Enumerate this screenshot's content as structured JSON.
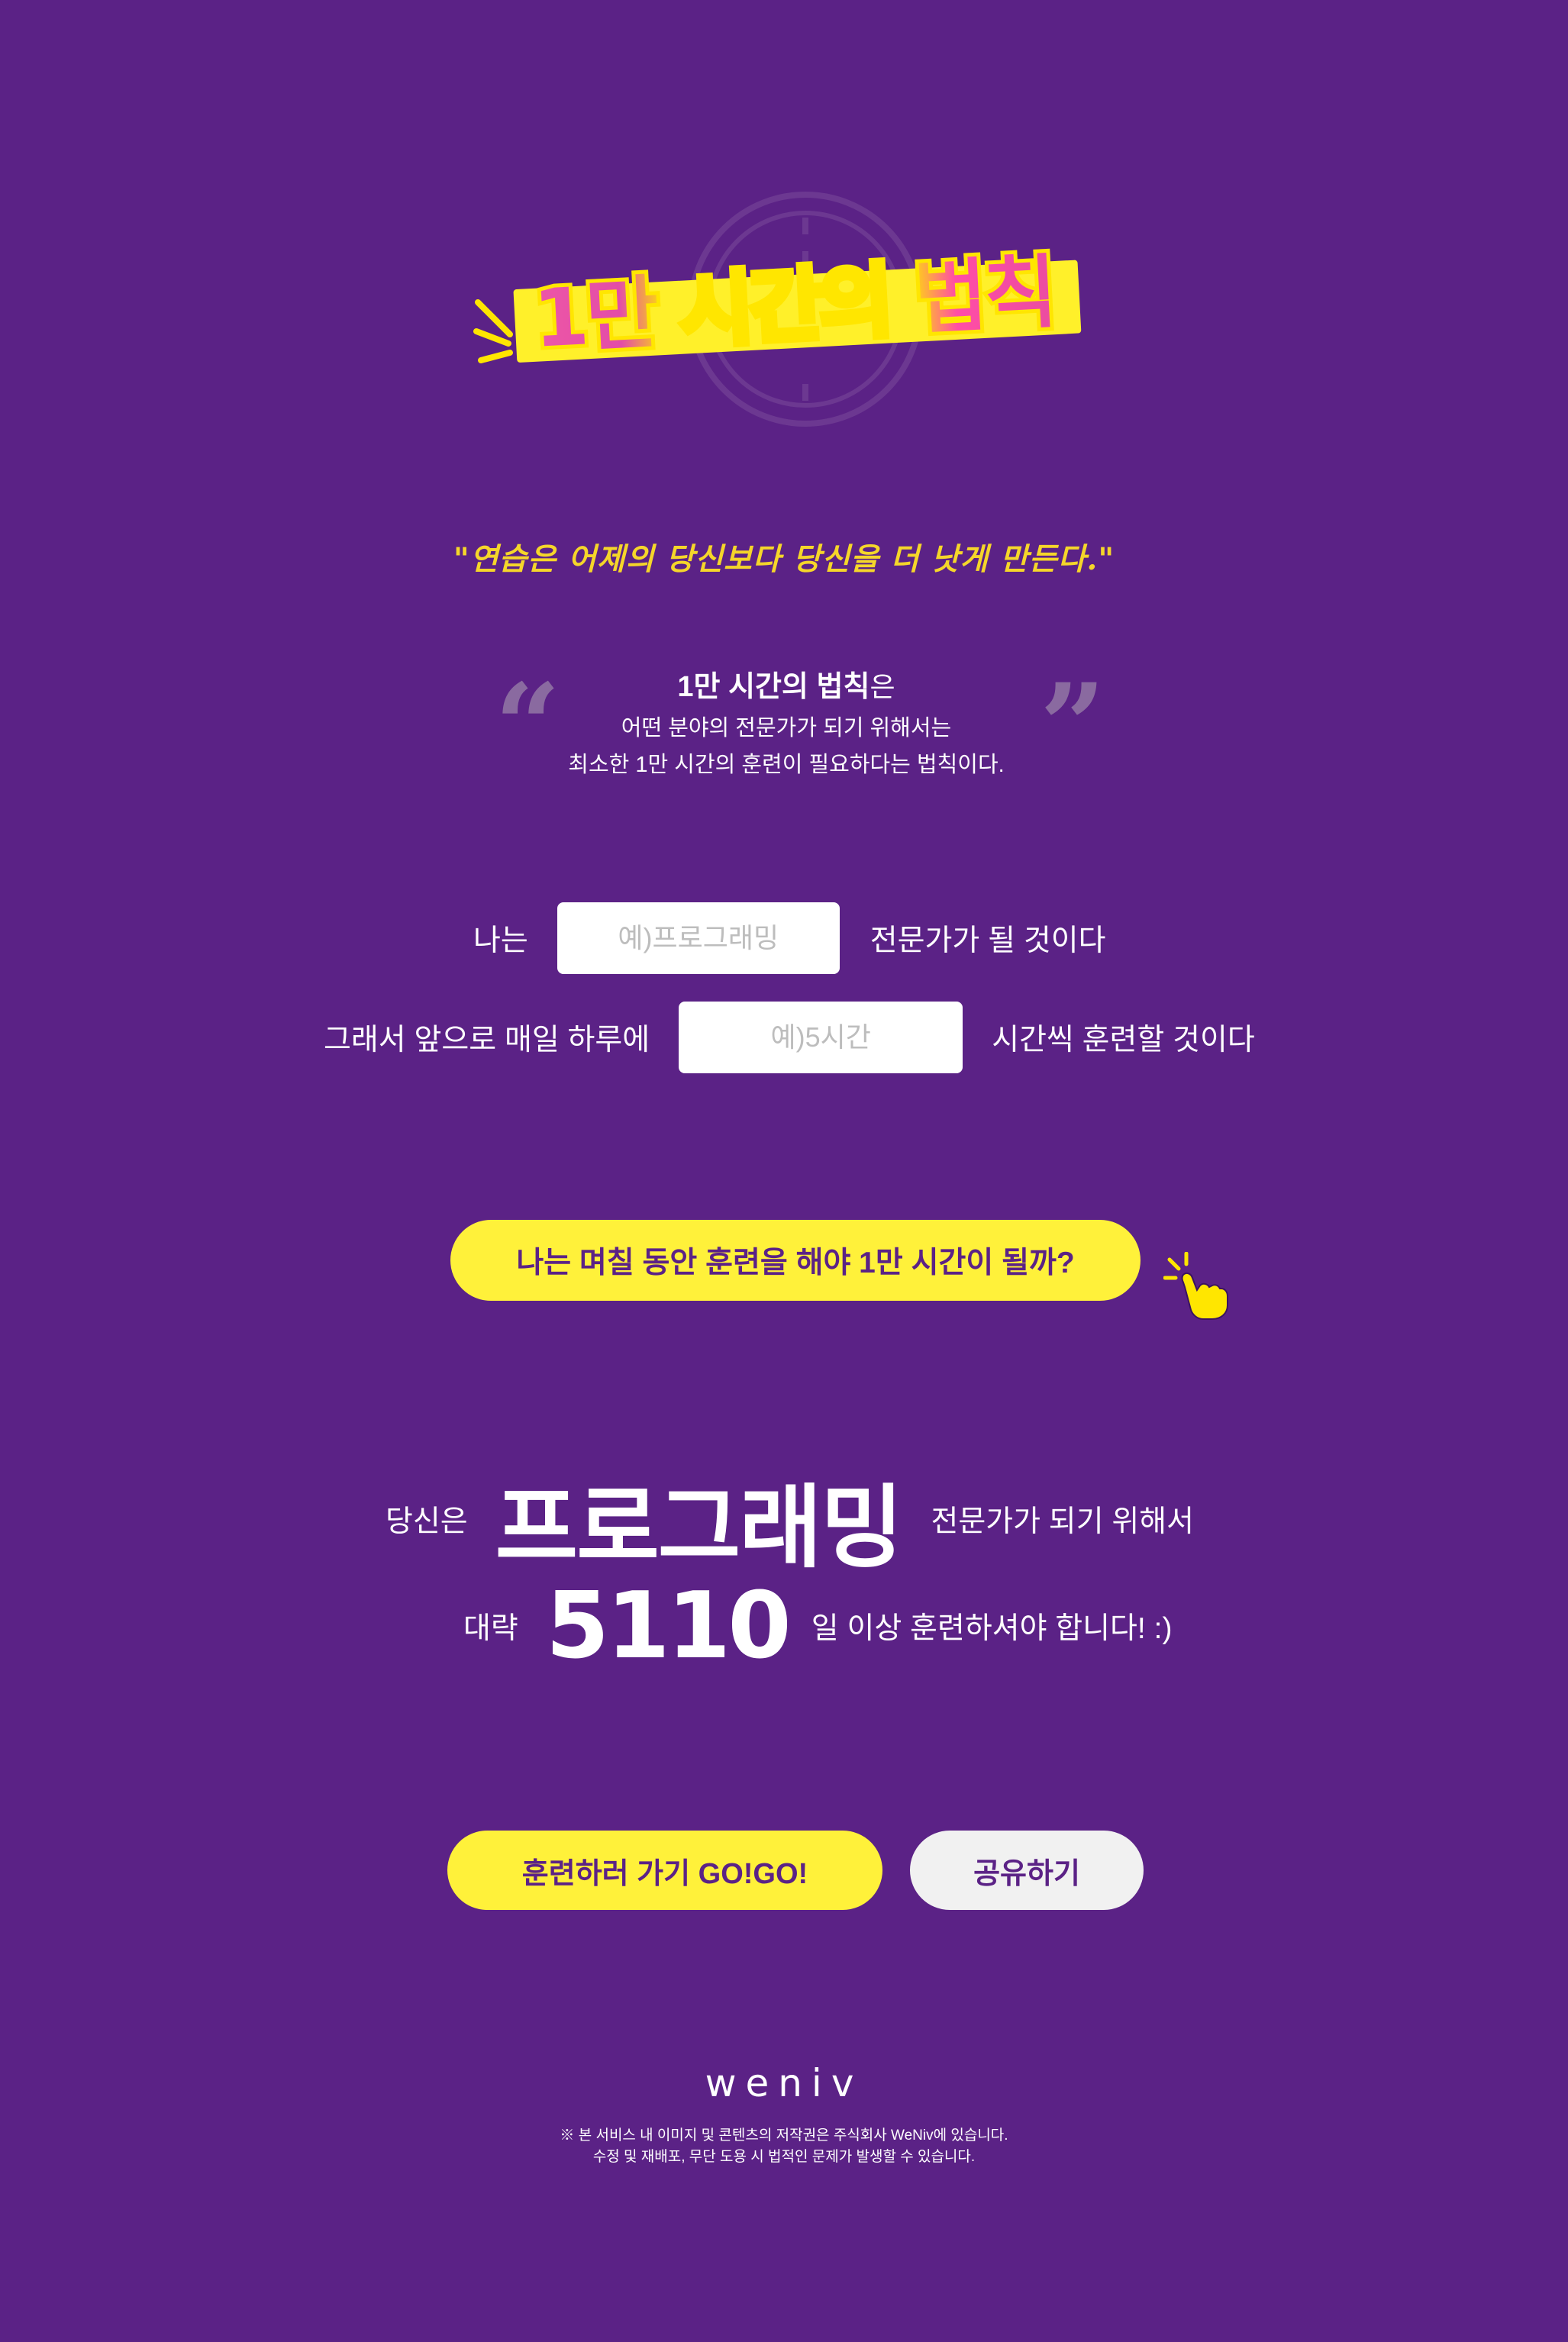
{
  "hero": {
    "title": "1만 시간의 법칙",
    "motto": "\"연습은 어제의 당신보다 당신을 더 낫게 만든다.\""
  },
  "quote": {
    "open_mark": "“",
    "close_mark": "”",
    "emphasis": "1만 시간의 법칙",
    "emphasis_suffix": "은",
    "line2": "어떤 분야의 전문가가 되기 위해서는",
    "line3": "최소한 1만 시간의 훈련이 필요하다는 법칙이다."
  },
  "form": {
    "row1_prefix": "나는",
    "field_placeholder": "예)프로그래밍",
    "row1_suffix": "전문가가 될 것이다",
    "row2_prefix": "그래서 앞으로 매일 하루에",
    "hours_placeholder": "예)5시간",
    "row2_suffix": "시간씩 훈련할 것이다"
  },
  "cta": {
    "label": "나는 며칠 동안 훈련을 해야 1만 시간이 될까?",
    "hand_icon": "pointing-hand-icon"
  },
  "result": {
    "prefix1": "당신은",
    "field": "프로그래밍",
    "suffix1": "전문가가 되기 위해서",
    "prefix2": "대략",
    "days": "5110",
    "suffix2": "일 이상 훈련하셔야 합니다! :)"
  },
  "actions": {
    "go_label": "훈련하러 가기 GO!GO!",
    "share_label": "공유하기"
  },
  "footer": {
    "logo": "weniv",
    "note_line1": "※ 본 서비스 내 이미지 및 콘텐츠의 저작권은 주식회사 WeNiv에 있습니다.",
    "note_line2": "수정 및 재배포, 무단 도용 시 법적인 문제가 발생할 수 있습니다."
  },
  "colors": {
    "background": "#5b2286",
    "accent_yellow": "#fff13a",
    "title_pink": "#e94ba4",
    "button_gray": "#f1f1f1"
  }
}
